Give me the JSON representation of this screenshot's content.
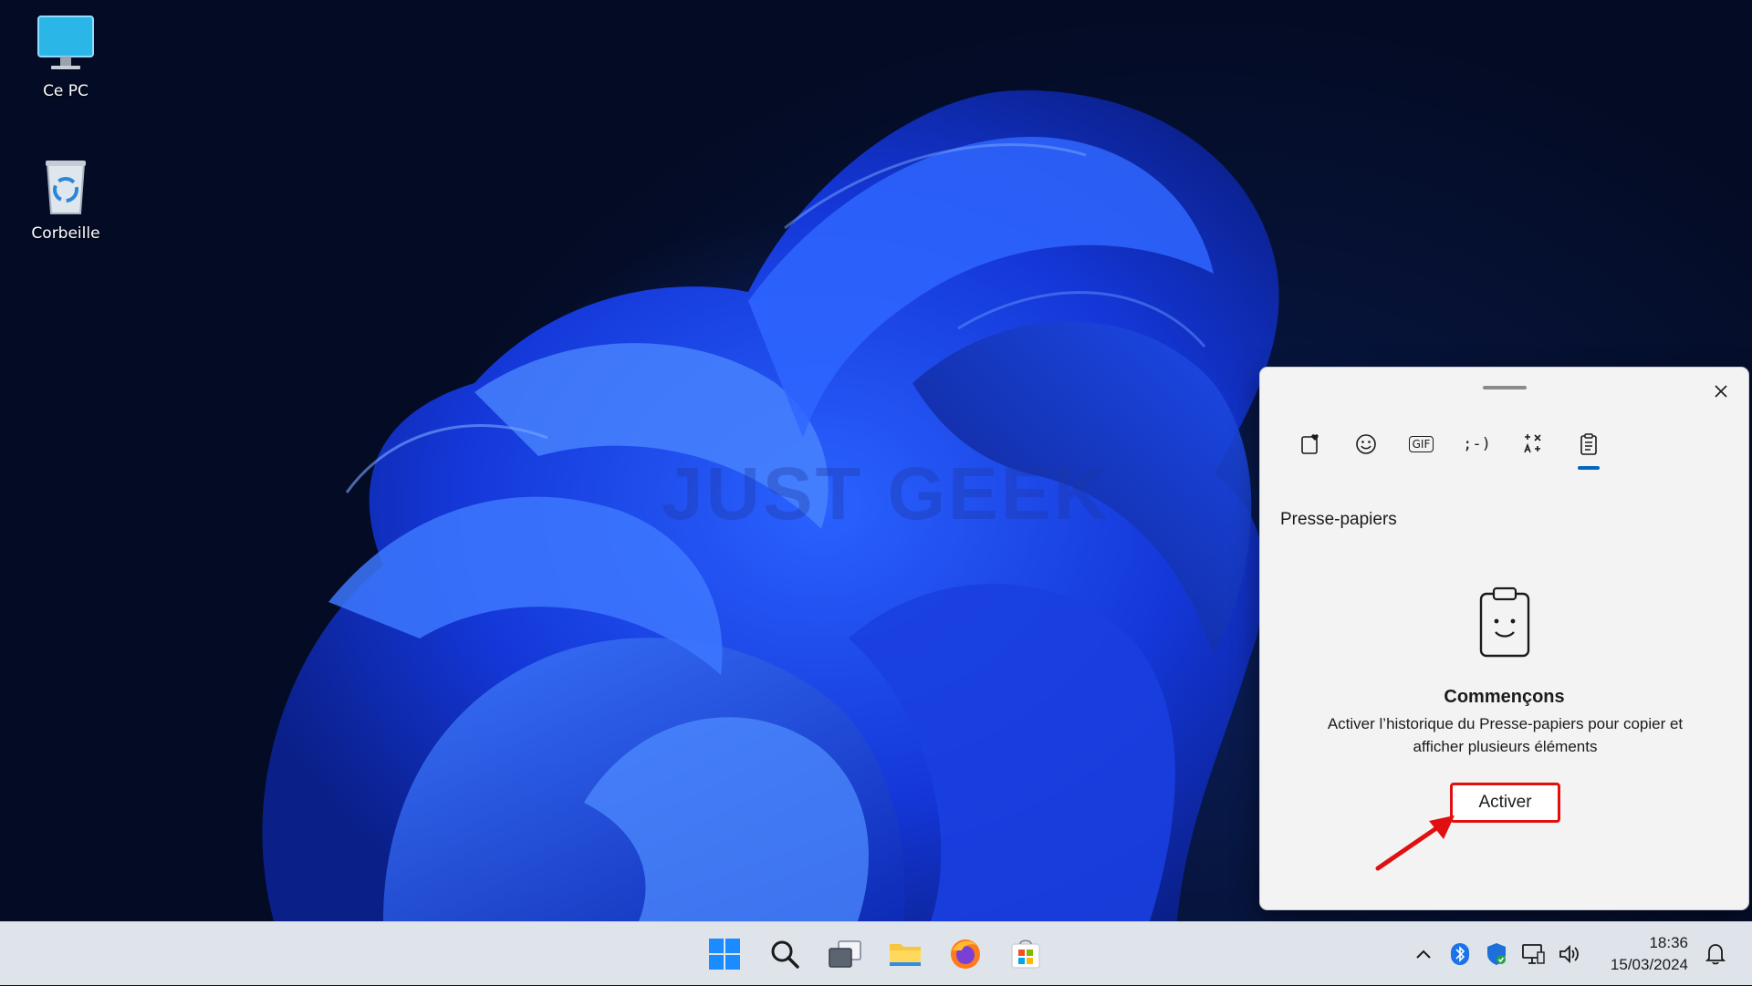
{
  "desktop": {
    "icons": [
      {
        "label": "Ce PC",
        "icon": "monitor-icon"
      },
      {
        "label": "Corbeille",
        "icon": "recycle-bin-icon"
      }
    ],
    "watermark": "JUST GEEK"
  },
  "clipboard_panel": {
    "tabs": [
      {
        "name": "favorites",
        "icon": "heart-clipboard-icon"
      },
      {
        "name": "emoji",
        "icon": "smiley-icon"
      },
      {
        "name": "gif",
        "icon": "gif-icon",
        "text": "GIF"
      },
      {
        "name": "kaomoji",
        "icon": "kaomoji-icon",
        "text": ";-)"
      },
      {
        "name": "symbols",
        "icon": "symbols-icon"
      },
      {
        "name": "clipboard",
        "icon": "clipboard-icon",
        "active": true
      }
    ],
    "section_title": "Presse-papiers",
    "empty_title": "Commençons",
    "empty_description": "Activer l’historique du Presse-papiers pour copier et afficher plusieurs éléments",
    "activate_label": "Activer",
    "highlight_color": "#e01010",
    "accent_color": "#0067c0"
  },
  "taskbar": {
    "apps": [
      {
        "name": "start",
        "icon": "windows-logo-icon"
      },
      {
        "name": "search",
        "icon": "search-icon"
      },
      {
        "name": "task-view",
        "icon": "task-view-icon"
      },
      {
        "name": "file-explorer",
        "icon": "folder-icon"
      },
      {
        "name": "firefox",
        "icon": "firefox-icon"
      },
      {
        "name": "microsoft-store",
        "icon": "store-icon"
      }
    ],
    "tray": {
      "icons": [
        "chevron-up-icon",
        "bluetooth-icon",
        "security-shield-icon",
        "network-icon",
        "volume-icon",
        "notification-bell-icon"
      ],
      "time": "18:36",
      "date": "15/03/2024"
    }
  }
}
